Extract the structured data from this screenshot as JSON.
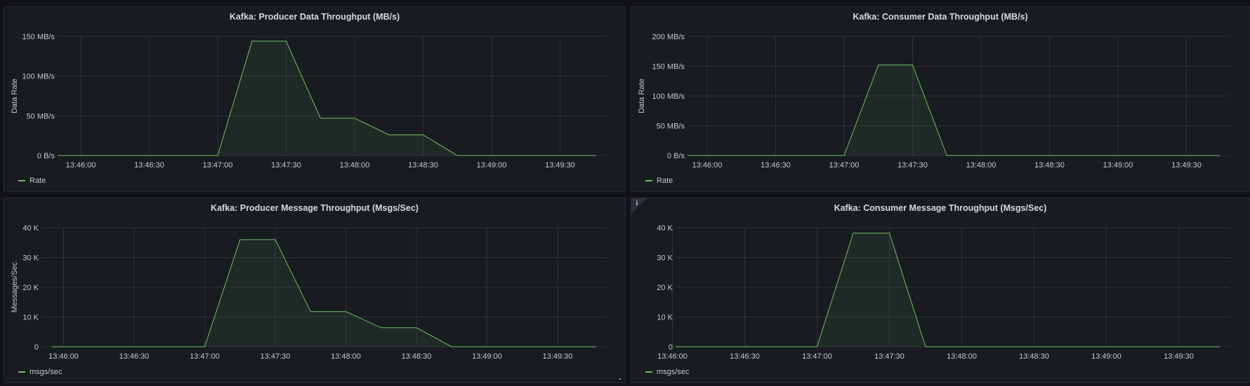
{
  "colors": {
    "series": "#73bf69",
    "fill": "rgba(115,191,105,0.09)",
    "grid": "rgba(204,204,220,0.12)",
    "background": "#181b1f"
  },
  "chart_data": [
    {
      "type": "area",
      "title": "Kafka: Producer Data Throughput (MB/s)",
      "ylabel": "Data Rate",
      "xlabel": "",
      "x_tick_labels": [
        "13:46:00",
        "13:46:30",
        "13:47:00",
        "13:47:30",
        "13:48:00",
        "13:48:30",
        "13:49:00",
        "13:49:30"
      ],
      "y_tick_labels": [
        "0 B/s",
        "50 MB/s",
        "100 MB/s",
        "150 MB/s"
      ],
      "y_ticks": [
        0,
        50,
        100,
        150
      ],
      "ylim": [
        0,
        150
      ],
      "xlim_seconds_from_13_45_45": [
        0,
        255
      ],
      "series": [
        {
          "name": "Rate",
          "x": [
            "13:45:45",
            "13:47:00",
            "13:47:15",
            "13:47:30",
            "13:47:45",
            "13:48:00",
            "13:48:15",
            "13:48:30",
            "13:48:45",
            "13:49:00",
            "13:50:00"
          ],
          "values": [
            0,
            0,
            144,
            144,
            47,
            47,
            26,
            26,
            0,
            0,
            0
          ]
        }
      ],
      "legend_position": "bottom-left",
      "grid": true
    },
    {
      "type": "area",
      "title": "Kafka: Consumer Data Throughput (MB/s)",
      "ylabel": "Data Rate",
      "xlabel": "",
      "x_tick_labels": [
        "13:46:00",
        "13:46:30",
        "13:47:00",
        "13:47:30",
        "13:48:00",
        "13:48:30",
        "13:49:00",
        "13:49:30"
      ],
      "y_tick_labels": [
        "0 B/s",
        "50 MB/s",
        "100 MB/s",
        "150 MB/s",
        "200 MB/s"
      ],
      "y_ticks": [
        0,
        50,
        100,
        150,
        200
      ],
      "ylim": [
        0,
        200
      ],
      "series": [
        {
          "name": "Rate",
          "x": [
            "13:45:45",
            "13:47:00",
            "13:47:15",
            "13:47:30",
            "13:47:45",
            "13:50:00"
          ],
          "values": [
            0,
            0,
            152,
            152,
            0,
            0
          ]
        }
      ],
      "legend_position": "bottom-left",
      "grid": true
    },
    {
      "type": "area",
      "title": "Kafka: Producer Message Throughput (Msgs/Sec)",
      "ylabel": "Messages/Sec",
      "xlabel": "",
      "x_tick_labels": [
        "13:46:00",
        "13:46:30",
        "13:47:00",
        "13:47:30",
        "13:48:00",
        "13:48:30",
        "13:49:00",
        "13:49:30"
      ],
      "y_tick_labels": [
        "0",
        "10 K",
        "20 K",
        "30 K",
        "40 K"
      ],
      "y_ticks": [
        0,
        10000,
        20000,
        30000,
        40000
      ],
      "ylim": [
        0,
        40000
      ],
      "series": [
        {
          "name": "msgs/sec",
          "x": [
            "13:45:55",
            "13:47:00",
            "13:47:15",
            "13:47:30",
            "13:47:45",
            "13:48:00",
            "13:48:15",
            "13:48:30",
            "13:48:45",
            "13:50:00"
          ],
          "values": [
            0,
            0,
            36000,
            36000,
            11800,
            11800,
            6400,
            6400,
            0,
            0
          ]
        }
      ],
      "legend_position": "bottom-left",
      "grid": true
    },
    {
      "type": "area",
      "title": "Kafka: Consumer Message Throughput (Msgs/Sec)",
      "ylabel": "",
      "xlabel": "",
      "x_tick_labels": [
        "13:46:00",
        "13:46:30",
        "13:47:00",
        "13:47:30",
        "13:48:00",
        "13:48:30",
        "13:49:00",
        "13:49:30"
      ],
      "y_tick_labels": [
        "0",
        "10 K",
        "20 K",
        "30 K",
        "40 K"
      ],
      "y_ticks": [
        0,
        10000,
        20000,
        30000,
        40000
      ],
      "ylim": [
        0,
        40000
      ],
      "series": [
        {
          "name": "msgs/sec",
          "x": [
            "13:45:55",
            "13:47:00",
            "13:47:15",
            "13:47:30",
            "13:47:45",
            "13:50:00"
          ],
          "values": [
            0,
            0,
            38200,
            38200,
            0,
            0
          ]
        }
      ],
      "legend_position": "bottom-left",
      "grid": true,
      "info_icon": "info-icon"
    }
  ],
  "panels": [
    {
      "title": "Kafka: Producer Data Throughput (MB/s)",
      "legend": "Rate"
    },
    {
      "title": "Kafka: Consumer Data Throughput (MB/s)",
      "legend": "Rate"
    },
    {
      "title": "Kafka: Producer Message Throughput (Msgs/Sec)",
      "legend": "msgs/sec"
    },
    {
      "title": "Kafka: Consumer Message Throughput (Msgs/Sec)",
      "legend": "msgs/sec",
      "info_glyph": "ℹ"
    }
  ]
}
